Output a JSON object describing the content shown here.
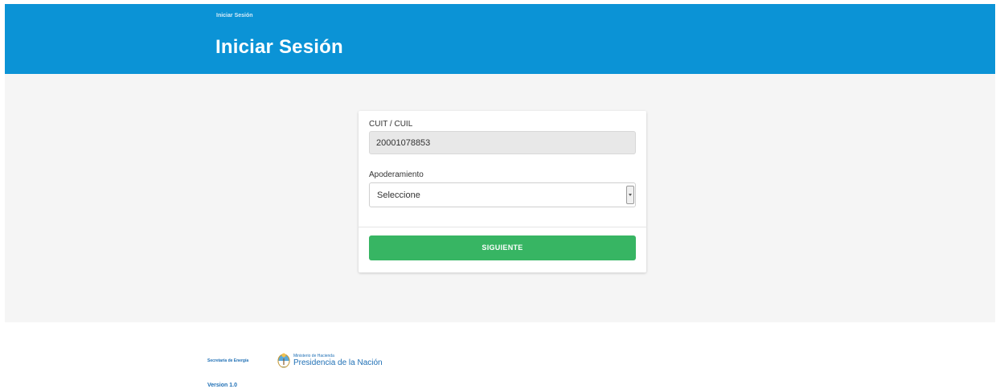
{
  "header": {
    "breadcrumb": "Iniciar Sesión",
    "title": "Iniciar Sesión"
  },
  "form": {
    "cuit_label": "CUIT / CUIL",
    "cuit_value": "20001078853",
    "apoderamiento_label": "Apoderamiento",
    "apoderamiento_selected": "Seleccione",
    "submit_label": "SIGUIENTE"
  },
  "footer": {
    "secretaria": "Secretaría de Energía",
    "ministerio": "Ministerio de Hacienda",
    "presidencia": "Presidencia de la Nación",
    "version": "Version 1.0"
  },
  "colors": {
    "header_bg": "#0b93d6",
    "button_bg": "#37b563",
    "footer_text": "#1e6fb5"
  },
  "icons": [
    "argentina-emblem-icon",
    "chevron-down-icon"
  ]
}
